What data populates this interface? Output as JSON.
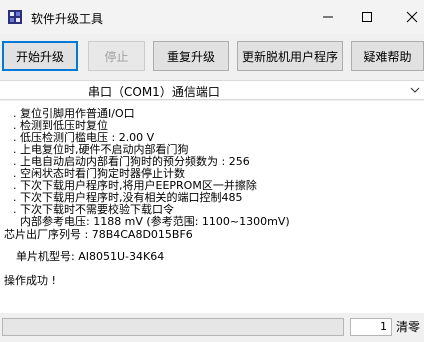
{
  "window": {
    "title": "软件升级工具",
    "controls": [
      "minimize-icon",
      "maximize-icon",
      "close-icon"
    ]
  },
  "toolbar": {
    "buttons": [
      {
        "label": "开始升级",
        "state": "focused"
      },
      {
        "label": "停止",
        "state": "disabled"
      },
      {
        "label": "重复升级",
        "state": "normal"
      },
      {
        "label": "更新脱机用户程序",
        "state": "normal"
      },
      {
        "label": "疑难帮助",
        "state": "normal"
      }
    ]
  },
  "port": {
    "selected": "串口（COM1）通信端口"
  },
  "log": {
    "lines": [
      ". 复位引脚用作普通I/O口",
      ". 检测到低压时复位",
      ". 低压检测门槛电压 : 2.00 V",
      ". 上电复位时,硬件不启动内部看门狗",
      ". 上电自动启动内部看门狗时的预分频数为 : 256",
      ". 空闲状态时看门狗定时器停止计数",
      ". 下次下载用户程序时,将用户EEPROM区一并擦除",
      ". 下次下载用户程序时,没有相关的端口控制485",
      ". 下次下载时不需要校验下载口令",
      "  内部参考电压: 1188 mV (参考范围: 1100~1300mV)",
      "芯片出厂序列号 : 78B4CA8D015BF6",
      "单片机型号: AI8051U-34K64",
      "操作成功 !"
    ]
  },
  "statusbar": {
    "message": "",
    "count": "1",
    "clear_label": "清零"
  }
}
